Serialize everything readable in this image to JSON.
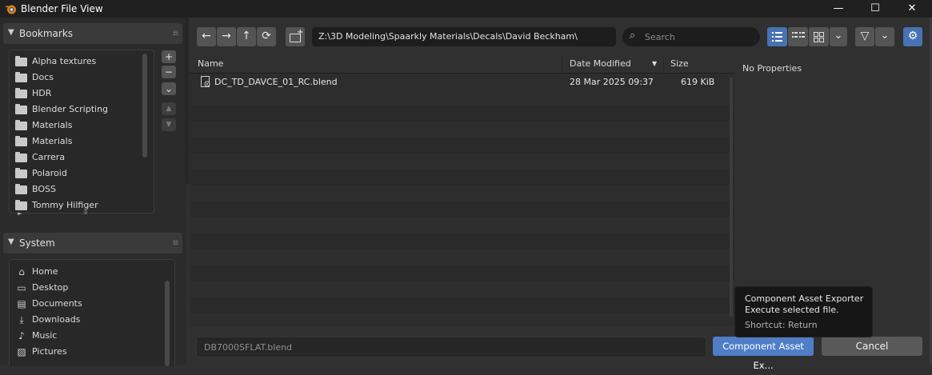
{
  "window": {
    "title": "Blender File View",
    "minimize_glyph": "—",
    "maximize_glyph": "☐",
    "close_glyph": "✕"
  },
  "bookmarks": {
    "title": "Bookmarks",
    "items": [
      "Alpha textures",
      "Docs",
      "HDR",
      "Blender Scripting",
      "Materials",
      "Materials",
      "Carrera",
      "Polaroid",
      "BOSS",
      "Tommy Hilfiger"
    ],
    "add_glyph": "+",
    "remove_glyph": "−",
    "menu_glyph": "⌄",
    "up_glyph": "▲",
    "down_glyph": "▼",
    "more_glyph": "►"
  },
  "system": {
    "title": "System",
    "items": [
      {
        "label": "Home",
        "icon": "home-icon",
        "glyph": "⌂"
      },
      {
        "label": "Desktop",
        "icon": "desktop-icon",
        "glyph": "▭"
      },
      {
        "label": "Documents",
        "icon": "documents-icon",
        "glyph": "▤"
      },
      {
        "label": "Downloads",
        "icon": "downloads-icon",
        "glyph": "⤓"
      },
      {
        "label": "Music",
        "icon": "music-icon",
        "glyph": "♪"
      },
      {
        "label": "Pictures",
        "icon": "pictures-icon",
        "glyph": "▨"
      }
    ]
  },
  "toolbar": {
    "back_glyph": "←",
    "forward_glyph": "→",
    "parent_glyph": "↑",
    "refresh_glyph": "⟳",
    "new_folder_glyph": "+",
    "path": "Z:\\3D Modeling\\Spaarkly Materials\\Decals\\David Beckham\\",
    "search_placeholder": "Search",
    "search_glyph": "⌕",
    "filter_glyph": "▽",
    "dropdown_glyph": "⌄",
    "settings_glyph": "⚙"
  },
  "columns": {
    "name": "Name",
    "date": "Date Modified",
    "size": "Size",
    "sort_glyph": "▼"
  },
  "files": [
    {
      "name": "DC_TD_DAVCE_01_RC.blend",
      "date": "28 Mar 2025 09:37",
      "size": "619 KiB"
    }
  ],
  "properties": {
    "empty_text": "No Properties"
  },
  "footer": {
    "filename": "DB7000SFLAT.blend",
    "execute_label": "Component Asset Ex...",
    "cancel_label": "Cancel"
  },
  "tooltip": {
    "title": "Component Asset Exporter",
    "description": "Execute selected file.",
    "shortcut": "Shortcut: Return"
  },
  "colors": {
    "accent": "#4772b3",
    "execute_button": "#4f7ec7",
    "background": "#303030"
  }
}
